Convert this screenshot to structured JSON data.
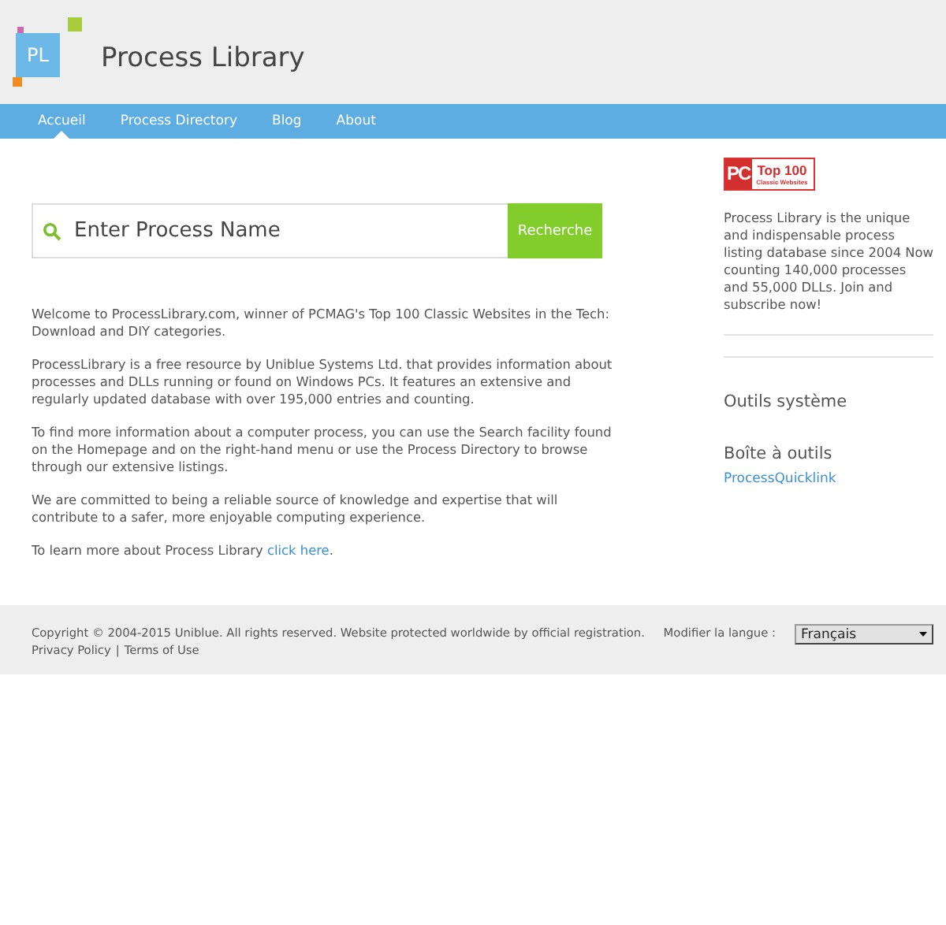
{
  "header": {
    "logo_text": "PL",
    "title": "Process Library"
  },
  "nav": [
    {
      "label": "Accueil",
      "selected": true
    },
    {
      "label": "Process Directory",
      "selected": false
    },
    {
      "label": "Blog",
      "selected": false
    },
    {
      "label": "About",
      "selected": false
    }
  ],
  "search": {
    "placeholder": "Enter Process Name",
    "button": "Recherche"
  },
  "paragraphs": [
    {
      "text": "Welcome to ProcessLibrary.com, winner of PCMAG's Top 100 Classic Websites in the Tech: Download and DIY categories."
    },
    {
      "text": "ProcessLibrary is a free resource by Uniblue Systems Ltd. that provides information about processes and DLLs running or found on Windows PCs. It features an extensive and regularly updated database with over 195,000 entries and counting."
    },
    {
      "text": "To find more information about a computer process, you can use the Search facility found on the Homepage and on the right-hand menu or use the Process Directory to browse through our extensive listings."
    },
    {
      "text": "We are committed to being a reliable source of knowledge and expertise that will contribute to a safer, more enjoyable computing experience."
    },
    {
      "text": "To learn more about Process Library ",
      "link": "click here",
      "after": "."
    }
  ],
  "sidebar": {
    "badge": {
      "mark": "PC",
      "title": "Top 100",
      "subtitle": "Classic Websites"
    },
    "blurb": "Process Library is the unique and indispensable process listing database since 2004 Now counting 140,000 processes and 55,000 DLLs. Join and subscribe now!",
    "sections": [
      {
        "heading": "Outils système"
      },
      {
        "heading": "Boîte à outils",
        "links": [
          "ProcessQuicklink"
        ]
      }
    ]
  },
  "footer": {
    "copyright": "Copyright © 2004-2015 Uniblue. All rights reserved. Website protected worldwide by official registration.",
    "links": [
      "Privacy Policy",
      "Terms of Use"
    ],
    "separator": "|",
    "language_label": "Modifier la langue :",
    "language": "Français"
  }
}
